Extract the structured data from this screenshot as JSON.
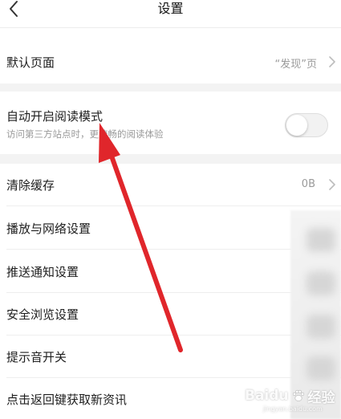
{
  "header": {
    "title": "设置"
  },
  "settings": {
    "default_page": {
      "label": "默认页面",
      "value": "“发现”页"
    },
    "auto_read": {
      "label": "自动开启阅读模式",
      "description": "访问第三方站点时，更流畅的阅读体验",
      "enabled": false
    },
    "clear_cache": {
      "label": "清除缓存",
      "value": "0B"
    },
    "playback_network": {
      "label": "播放与网络设置"
    },
    "push_notifications": {
      "label": "推送通知设置"
    },
    "safe_browsing": {
      "label": "安全浏览设置"
    },
    "sound_toggle": {
      "label": "提示音开关"
    },
    "back_refresh": {
      "label": "点击返回键获取新资讯"
    }
  },
  "annotation": {
    "arrow_color": "#e0262b"
  },
  "watermark": {
    "brand": "Baidu",
    "suffix": "经验",
    "url": "jingyan.baidu.com"
  }
}
